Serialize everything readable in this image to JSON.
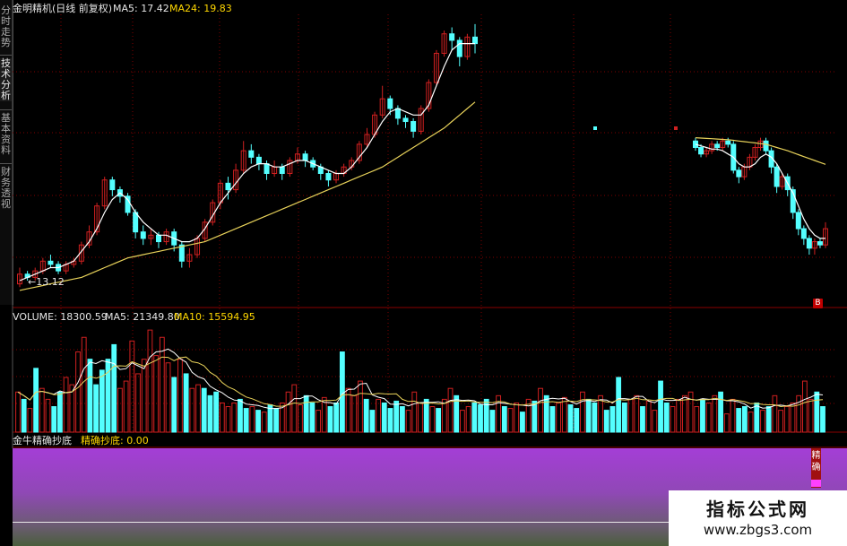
{
  "sidebar": {
    "tabs": [
      {
        "label": "分时走势"
      },
      {
        "label": "技术分析"
      },
      {
        "label": "基本资料"
      },
      {
        "label": "财务透视"
      }
    ]
  },
  "price_panel": {
    "title": "金明精机(日线 前复权)",
    "ma5_label": "MA5: 17.42",
    "ma24_label": "MA24: 19.83",
    "low_annotation": "←13.12",
    "badge": "B"
  },
  "volume_panel": {
    "volume_label": "VOLUME: 18300.59",
    "ma5_label": "MA5: 21349.80",
    "ma10_label": "MA10: 15594.95"
  },
  "indicator_panel": {
    "name": "金牛精确抄底",
    "value_label": "精确抄底: 0.00",
    "signal_text": "精确"
  },
  "watermark": {
    "title": "指标公式网",
    "url": "www.zbgs3.com"
  },
  "colors": {
    "up": "#d02020",
    "down": "#54ffff",
    "ma_short": "#ffffff",
    "ma_long": "#e8d25a",
    "grid": "#800000",
    "panel_border": "#8a0000"
  },
  "chart_data": [
    {
      "type": "candlestick",
      "title": "金明精机(日线 前复权)",
      "y_range": [
        12.5,
        21.5
      ],
      "candles": [
        [
          13.2,
          13.5,
          13.1,
          13.7
        ],
        [
          13.5,
          13.4,
          13.3,
          13.6
        ],
        [
          13.4,
          13.6,
          13.3,
          13.7
        ],
        [
          13.6,
          13.9,
          13.5,
          14.0
        ],
        [
          13.9,
          13.8,
          13.7,
          14.1
        ],
        [
          13.8,
          13.6,
          13.5,
          13.9
        ],
        [
          13.6,
          13.8,
          13.5,
          13.9
        ],
        [
          13.8,
          13.9,
          13.7,
          14.0
        ],
        [
          13.9,
          14.4,
          13.8,
          14.5
        ],
        [
          14.4,
          14.8,
          14.3,
          15.0
        ],
        [
          14.8,
          15.6,
          14.7,
          15.7
        ],
        [
          15.6,
          16.4,
          15.5,
          16.5
        ],
        [
          16.4,
          16.1,
          15.9,
          16.5
        ],
        [
          16.1,
          15.9,
          15.7,
          16.2
        ],
        [
          15.9,
          15.4,
          15.3,
          16.0
        ],
        [
          15.4,
          14.8,
          14.6,
          15.5
        ],
        [
          14.8,
          14.6,
          14.4,
          15.0
        ],
        [
          14.6,
          14.7,
          14.4,
          14.9
        ],
        [
          14.7,
          14.5,
          14.3,
          14.8
        ],
        [
          14.5,
          14.8,
          14.4,
          14.9
        ],
        [
          14.8,
          14.4,
          14.2,
          14.9
        ],
        [
          14.4,
          13.9,
          13.7,
          14.5
        ],
        [
          13.9,
          14.1,
          13.7,
          14.3
        ],
        [
          14.1,
          14.6,
          14.0,
          14.7
        ],
        [
          14.6,
          15.1,
          14.5,
          15.2
        ],
        [
          15.1,
          15.7,
          15.0,
          15.8
        ],
        [
          15.7,
          16.3,
          15.5,
          16.4
        ],
        [
          16.3,
          16.1,
          15.8,
          16.5
        ],
        [
          16.1,
          16.7,
          16.0,
          16.9
        ],
        [
          16.7,
          17.3,
          16.6,
          17.6
        ],
        [
          17.3,
          17.1,
          16.9,
          17.5
        ],
        [
          17.1,
          16.9,
          16.7,
          17.2
        ],
        [
          16.9,
          16.6,
          16.4,
          17.0
        ],
        [
          16.6,
          16.8,
          16.5,
          17.0
        ],
        [
          16.8,
          16.6,
          16.4,
          16.9
        ],
        [
          16.6,
          17.0,
          16.5,
          17.1
        ],
        [
          17.0,
          17.2,
          16.9,
          17.4
        ],
        [
          17.2,
          17.0,
          16.8,
          17.3
        ],
        [
          17.0,
          16.8,
          16.7,
          17.1
        ],
        [
          16.8,
          16.6,
          16.4,
          16.9
        ],
        [
          16.6,
          16.4,
          16.2,
          16.7
        ],
        [
          16.4,
          16.6,
          16.3,
          16.7
        ],
        [
          16.6,
          16.8,
          16.5,
          16.9
        ],
        [
          16.8,
          17.0,
          16.7,
          17.1
        ],
        [
          17.0,
          17.5,
          16.9,
          17.6
        ],
        [
          17.5,
          17.8,
          17.4,
          18.0
        ],
        [
          17.8,
          18.4,
          17.7,
          18.5
        ],
        [
          18.4,
          18.9,
          18.3,
          19.3
        ],
        [
          18.9,
          18.6,
          18.4,
          19.0
        ],
        [
          18.6,
          18.3,
          18.1,
          18.7
        ],
        [
          18.3,
          18.2,
          18.0,
          18.4
        ],
        [
          18.2,
          17.9,
          17.7,
          18.3
        ],
        [
          17.9,
          18.6,
          17.8,
          18.7
        ],
        [
          18.6,
          19.4,
          18.5,
          19.5
        ],
        [
          19.4,
          20.3,
          19.3,
          20.4
        ],
        [
          20.3,
          20.9,
          20.2,
          21.0
        ],
        [
          20.9,
          20.7,
          20.4,
          21.1
        ],
        [
          20.7,
          20.2,
          19.9,
          20.8
        ],
        [
          20.2,
          20.8,
          20.1,
          20.9
        ],
        [
          20.8,
          20.6,
          20.3,
          21.2
        ]
      ],
      "ma5": [
        13.3,
        13.4,
        13.5,
        13.6,
        13.7,
        13.7,
        13.8,
        13.9,
        14.2,
        14.5,
        14.9,
        15.4,
        15.8,
        16.0,
        15.8,
        15.4,
        15.1,
        14.9,
        14.7,
        14.7,
        14.6,
        14.5,
        14.5,
        14.6,
        14.9,
        15.3,
        15.7,
        16.0,
        16.3,
        16.6,
        16.8,
        16.9,
        16.9,
        16.8,
        16.8,
        16.9,
        17.0,
        17.0,
        16.9,
        16.8,
        16.7,
        16.6,
        16.6,
        16.8,
        17.1,
        17.4,
        17.8,
        18.2,
        18.5,
        18.6,
        18.5,
        18.4,
        18.4,
        18.7,
        19.3,
        19.9,
        20.4,
        20.6,
        20.6,
        20.6
      ],
      "ma24": [
        13.0,
        13.05,
        13.1,
        13.15,
        13.2,
        13.25,
        13.3,
        13.35,
        13.4,
        13.5,
        13.6,
        13.7,
        13.8,
        13.9,
        14.0,
        14.05,
        14.1,
        14.15,
        14.2,
        14.25,
        14.3,
        14.35,
        14.4,
        14.45,
        14.5,
        14.6,
        14.7,
        14.8,
        14.9,
        15.0,
        15.1,
        15.2,
        15.3,
        15.4,
        15.5,
        15.6,
        15.7,
        15.8,
        15.9,
        16.0,
        16.1,
        16.2,
        16.3,
        16.4,
        16.5,
        16.6,
        16.7,
        16.8,
        16.95,
        17.1,
        17.25,
        17.4,
        17.55,
        17.7,
        17.85,
        18.0,
        18.2,
        18.4,
        18.6,
        18.8
      ],
      "right_candles": [
        [
          17.6,
          17.4,
          17.3,
          17.7
        ],
        [
          17.4,
          17.2,
          17.1,
          17.5
        ],
        [
          17.2,
          17.3,
          17.1,
          17.4
        ],
        [
          17.3,
          17.5,
          17.2,
          17.6
        ],
        [
          17.5,
          17.4,
          17.3,
          17.6
        ],
        [
          17.4,
          17.6,
          17.3,
          17.7
        ],
        [
          17.6,
          17.5,
          17.4,
          17.7
        ],
        [
          17.5,
          16.7,
          16.6,
          17.6
        ],
        [
          16.7,
          16.5,
          16.3,
          16.8
        ],
        [
          16.5,
          16.8,
          16.4,
          16.9
        ],
        [
          16.8,
          17.1,
          16.7,
          17.2
        ],
        [
          17.1,
          17.4,
          17.0,
          17.5
        ],
        [
          17.4,
          17.6,
          17.3,
          17.7
        ],
        [
          17.6,
          17.3,
          17.2,
          17.7
        ],
        [
          17.3,
          16.8,
          16.6,
          17.4
        ],
        [
          16.8,
          16.2,
          16.0,
          16.9
        ],
        [
          16.2,
          16.5,
          16.1,
          16.6
        ],
        [
          16.5,
          16.1,
          15.9,
          16.6
        ],
        [
          16.1,
          15.4,
          15.2,
          16.2
        ],
        [
          15.4,
          14.9,
          14.7,
          15.5
        ],
        [
          14.9,
          14.6,
          14.4,
          15.0
        ],
        [
          14.6,
          14.3,
          14.1,
          14.7
        ],
        [
          14.3,
          14.5,
          14.1,
          14.6
        ],
        [
          14.5,
          14.4,
          14.3,
          14.6
        ],
        [
          14.4,
          14.9,
          14.3,
          15.1
        ]
      ],
      "right_ma5": [
        17.5,
        17.45,
        17.4,
        17.35,
        17.35,
        17.3,
        17.2,
        17.1,
        16.9,
        16.8,
        16.8,
        16.9,
        17.1,
        17.2,
        17.1,
        16.9,
        16.6,
        16.3,
        16.0,
        15.6,
        15.2,
        14.9,
        14.7,
        14.6,
        14.6
      ],
      "right_ma24": [
        17.7,
        17.69,
        17.68,
        17.67,
        17.66,
        17.65,
        17.64,
        17.62,
        17.6,
        17.58,
        17.56,
        17.54,
        17.52,
        17.5,
        17.45,
        17.4,
        17.35,
        17.3,
        17.24,
        17.18,
        17.12,
        17.06,
        17.0,
        16.94,
        16.88
      ],
      "annotations": [
        "←13.12"
      ],
      "legend": [
        "MA5: 17.42",
        "MA24: 19.83"
      ]
    },
    {
      "type": "bar",
      "title": "VOLUME: 18300.59",
      "y_range": [
        0,
        30000
      ],
      "legend": [
        "MA5: 21349.80",
        "MA10: 15594.95"
      ],
      "bars": [
        [
          11000,
          1
        ],
        [
          9000,
          0
        ],
        [
          6500,
          1
        ],
        [
          17500,
          0
        ],
        [
          12000,
          1
        ],
        [
          9000,
          1
        ],
        [
          7000,
          0
        ],
        [
          11000,
          0
        ],
        [
          15000,
          1
        ],
        [
          13000,
          1
        ],
        [
          22000,
          1
        ],
        [
          26000,
          1
        ],
        [
          20000,
          0
        ],
        [
          13000,
          0
        ],
        [
          17000,
          0
        ],
        [
          20000,
          0
        ],
        [
          24000,
          0
        ],
        [
          12000,
          1
        ],
        [
          14000,
          1
        ],
        [
          25000,
          1
        ],
        [
          16000,
          1
        ],
        [
          20000,
          1
        ],
        [
          28000,
          1
        ],
        [
          21000,
          1
        ],
        [
          26000,
          1
        ],
        [
          19000,
          1
        ],
        [
          15000,
          0
        ],
        [
          20000,
          1
        ],
        [
          16000,
          0
        ],
        [
          12000,
          1
        ],
        [
          13000,
          1
        ],
        [
          12000,
          0
        ],
        [
          10000,
          0
        ],
        [
          11000,
          0
        ],
        [
          8000,
          1
        ],
        [
          7000,
          1
        ],
        [
          8000,
          1
        ],
        [
          9000,
          0
        ],
        [
          6500,
          0
        ],
        [
          7000,
          1
        ],
        [
          6000,
          0
        ],
        [
          5500,
          1
        ],
        [
          7500,
          0
        ],
        [
          6500,
          0
        ],
        [
          8000,
          1
        ],
        [
          11000,
          1
        ],
        [
          13000,
          1
        ],
        [
          7500,
          1
        ],
        [
          10000,
          0
        ],
        [
          8000,
          0
        ],
        [
          6000,
          1
        ],
        [
          9500,
          1
        ],
        [
          7000,
          0
        ],
        [
          8000,
          0
        ],
        [
          22000,
          0
        ],
        [
          12000,
          1
        ],
        [
          10000,
          1
        ],
        [
          14000,
          1
        ],
        [
          9000,
          0
        ],
        [
          6000,
          0
        ],
        [
          9000,
          1
        ],
        [
          8000,
          0
        ],
        [
          6500,
          0
        ],
        [
          8500,
          0
        ],
        [
          7000,
          0
        ],
        [
          6000,
          1
        ],
        [
          11000,
          1
        ],
        [
          8000,
          1
        ],
        [
          9000,
          0
        ],
        [
          7000,
          1
        ],
        [
          6500,
          0
        ],
        [
          9000,
          1
        ],
        [
          12000,
          1
        ],
        [
          10000,
          0
        ],
        [
          6000,
          1
        ],
        [
          7000,
          1
        ],
        [
          8000,
          0
        ],
        [
          7500,
          0
        ],
        [
          9000,
          0
        ],
        [
          6000,
          0
        ],
        [
          10000,
          1
        ],
        [
          7000,
          0
        ],
        [
          6500,
          1
        ],
        [
          8000,
          1
        ],
        [
          5500,
          0
        ],
        [
          9000,
          1
        ],
        [
          8500,
          0
        ],
        [
          12000,
          1
        ],
        [
          10000,
          0
        ],
        [
          7000,
          0
        ],
        [
          8000,
          1
        ],
        [
          9500,
          1
        ],
        [
          7500,
          0
        ],
        [
          6500,
          0
        ],
        [
          11000,
          1
        ],
        [
          9000,
          0
        ],
        [
          8000,
          0
        ],
        [
          10000,
          1
        ],
        [
          6000,
          0
        ],
        [
          7000,
          0
        ],
        [
          15000,
          0
        ],
        [
          8000,
          0
        ],
        [
          9000,
          1
        ],
        [
          10000,
          1
        ],
        [
          7000,
          0
        ],
        [
          8500,
          1
        ],
        [
          6000,
          1
        ],
        [
          14000,
          0
        ],
        [
          8000,
          0
        ],
        [
          7000,
          1
        ],
        [
          9000,
          1
        ],
        [
          10000,
          1
        ],
        [
          11000,
          1
        ],
        [
          7000,
          1
        ],
        [
          9000,
          0
        ],
        [
          8000,
          1
        ],
        [
          10000,
          1
        ],
        [
          11000,
          0
        ],
        [
          5000,
          1
        ],
        [
          9000,
          1
        ],
        [
          6500,
          0
        ],
        [
          7000,
          0
        ],
        [
          5500,
          1
        ],
        [
          8000,
          0
        ],
        [
          6000,
          1
        ],
        [
          7000,
          0
        ],
        [
          10000,
          1
        ],
        [
          6000,
          1
        ],
        [
          7000,
          1
        ],
        [
          8000,
          1
        ],
        [
          10000,
          1
        ],
        [
          14000,
          1
        ],
        [
          9000,
          1
        ],
        [
          11000,
          0
        ],
        [
          7000,
          0
        ]
      ]
    },
    {
      "type": "line",
      "title": "金牛精确抄底",
      "series": [
        {
          "name": "精确抄底",
          "values": [
            0
          ]
        }
      ]
    }
  ]
}
